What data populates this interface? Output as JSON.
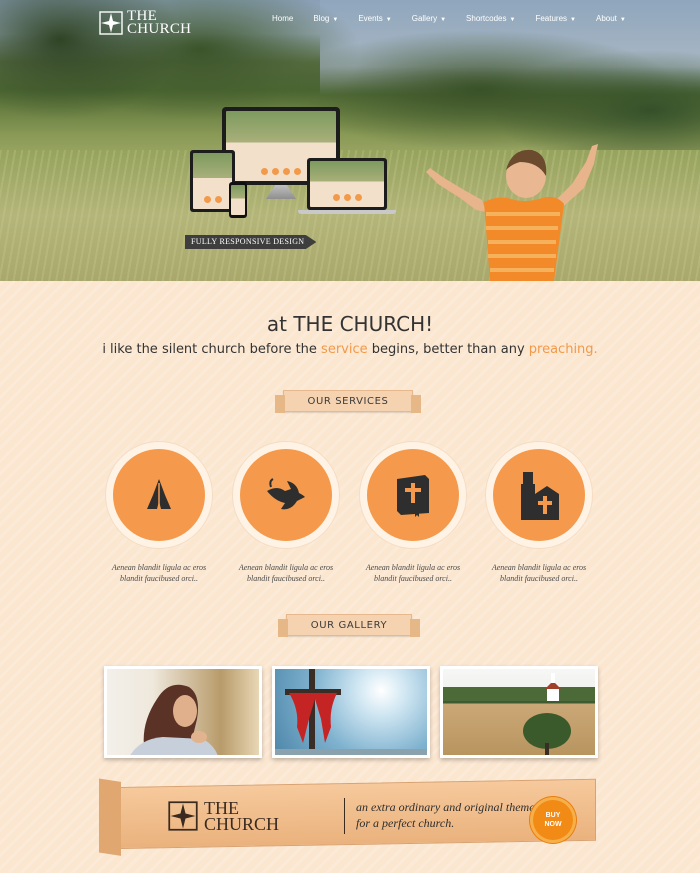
{
  "header": {
    "logo_line1": "THE",
    "logo_line2": "CHURCH",
    "nav": [
      {
        "label": "Home",
        "has_caret": false
      },
      {
        "label": "Blog",
        "has_caret": true
      },
      {
        "label": "Events",
        "has_caret": true
      },
      {
        "label": "Gallery",
        "has_caret": true
      },
      {
        "label": "Shortcodes",
        "has_caret": true
      },
      {
        "label": "Features",
        "has_caret": true
      },
      {
        "label": "About",
        "has_caret": true
      }
    ]
  },
  "hero": {
    "banner": "FULLY RESPONSIVE DESIGN"
  },
  "intro": {
    "title": "at THE CHURCH!",
    "sub_part1": "i like the silent church before the ",
    "sub_hl1": "service",
    "sub_part2": " begins, better than any ",
    "sub_hl2": "preaching."
  },
  "services": {
    "heading": "OUR SERVICES",
    "items": [
      {
        "icon": "praying-hands-icon",
        "text": "Aenean blandit ligula ac eros blandit faucibused orci.."
      },
      {
        "icon": "dove-icon",
        "text": "Aenean blandit ligula ac eros blandit faucibused orci.."
      },
      {
        "icon": "bible-icon",
        "text": "Aenean blandit ligula ac eros blandit faucibused orci.."
      },
      {
        "icon": "church-icon",
        "text": "Aenean blandit ligula ac eros blandit faucibused orci.."
      }
    ]
  },
  "gallery": {
    "heading": "OUR GALLERY"
  },
  "promo": {
    "logo_line1": "THE",
    "logo_line2": "CHURCH",
    "text": "an extra ordinary and original theme for a perfect church.",
    "buy_line1": "BUY",
    "buy_line2": "NOW"
  },
  "colors": {
    "accent": "#f59a4c",
    "background": "#fbe6d0"
  }
}
